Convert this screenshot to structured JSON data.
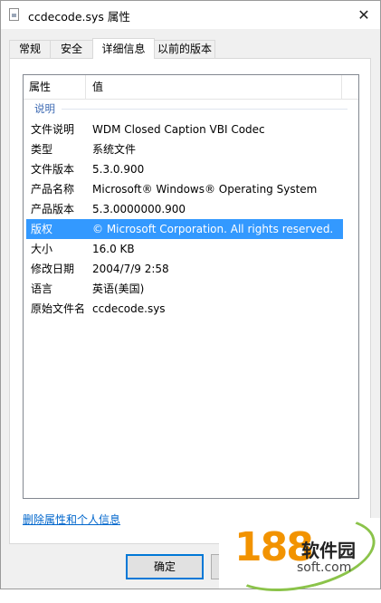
{
  "window": {
    "title": "ccdecode.sys 属性",
    "close_glyph": "✕"
  },
  "tabs": [
    {
      "label": "常规",
      "active": false
    },
    {
      "label": "安全",
      "active": false
    },
    {
      "label": "详细信息",
      "active": true
    },
    {
      "label": "以前的版本",
      "active": false
    }
  ],
  "details": {
    "columns": {
      "property": "属性",
      "value": "值"
    },
    "group": "说明",
    "rows": [
      {
        "key": "文件说明",
        "value": "WDM Closed Caption VBI Codec",
        "selected": false
      },
      {
        "key": "类型",
        "value": "系统文件",
        "selected": false
      },
      {
        "key": "文件版本",
        "value": "5.3.0.900",
        "selected": false
      },
      {
        "key": "产品名称",
        "value": "Microsoft® Windows® Operating System",
        "selected": false
      },
      {
        "key": "产品版本",
        "value": "5.3.0000000.900",
        "selected": false
      },
      {
        "key": "版权",
        "value": "© Microsoft Corporation. All rights reserved.",
        "selected": true
      },
      {
        "key": "大小",
        "value": "16.0 KB",
        "selected": false
      },
      {
        "key": "修改日期",
        "value": "2004/7/9 2:58",
        "selected": false
      },
      {
        "key": "语言",
        "value": "英语(美国)",
        "selected": false
      },
      {
        "key": "原始文件名",
        "value": "ccdecode.sys",
        "selected": false
      }
    ],
    "remove_link": "删除属性和个人信息"
  },
  "buttons": {
    "ok": "确定"
  },
  "watermark": {
    "number": "188",
    "name": "软件园",
    "domain": "soft.com"
  },
  "colors": {
    "selection": "#3399ff",
    "link": "#0066cc",
    "group_label": "#3d6ab3",
    "watermark_orange": "#f29300",
    "watermark_green": "#8bc34a"
  }
}
